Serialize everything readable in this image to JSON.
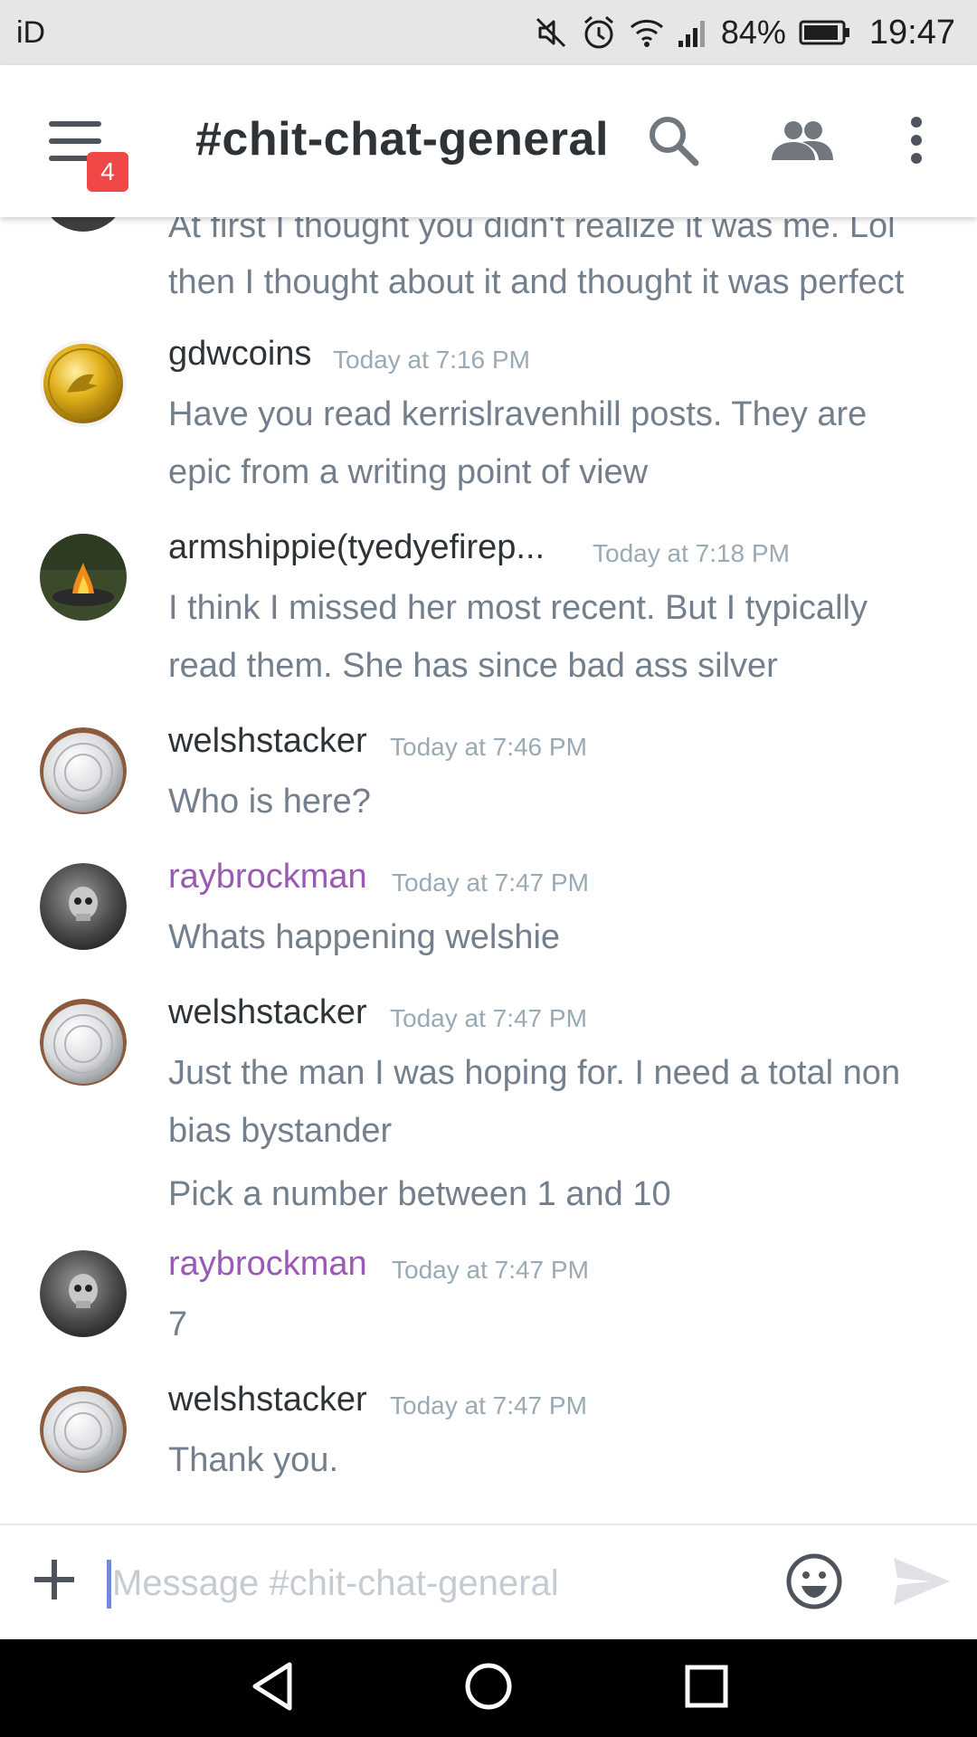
{
  "status_bar": {
    "carrier": "iD",
    "battery_percent": "84%",
    "time": "19:47",
    "icons": [
      "mute-icon",
      "alarm-icon",
      "wifi-icon",
      "signal-icon",
      "battery-icon"
    ],
    "background": "#e6e6e6"
  },
  "header": {
    "unread_badge": "4",
    "channel_title": "#chit-chat-general",
    "icons": [
      "menu-icon",
      "search-icon",
      "members-icon",
      "overflow-menu-icon"
    ],
    "badge_color": "#f04747"
  },
  "messages": [
    {
      "author": "",
      "timestamp": "",
      "lines": [
        "At first I thought you didn't realize it was me.  Lol",
        "then I thought about it and thought it was perfect"
      ],
      "avatar": "partial-avatar"
    },
    {
      "author": "gdwcoins",
      "timestamp": "Today at 7:16 PM",
      "lines": [
        "Have you read kerrislravenhill posts. They are",
        "epic from a writing point of view"
      ],
      "avatar": "gold-coin-avatar"
    },
    {
      "author": "armshippie(tyedyefirep...",
      "timestamp": "Today at 7:18 PM",
      "lines": [
        "I think I missed her most recent. But I typically",
        "read them. She has since bad ass silver"
      ],
      "avatar": "campfire-avatar"
    },
    {
      "author": "welshstacker",
      "timestamp": "Today at 7:46 PM",
      "lines": [
        "Who is here?"
      ],
      "avatar": "silver-coin-avatar"
    },
    {
      "author": "raybrockman",
      "timestamp": "Today at 7:47 PM",
      "lines": [
        "Whats happening welshie"
      ],
      "avatar": "skull-coin-avatar",
      "author_color": "#9b59b6"
    },
    {
      "author": "welshstacker",
      "timestamp": "Today at 7:47 PM",
      "lines": [
        "Just the man I was hoping for. I need a total non",
        "bias bystander",
        "Pick a number between 1 and 10"
      ],
      "avatar": "silver-coin-avatar"
    },
    {
      "author": "raybrockman",
      "timestamp": "Today at 7:47 PM",
      "lines": [
        "7"
      ],
      "avatar": "skull-coin-avatar",
      "author_color": "#9b59b6"
    },
    {
      "author": "welshstacker",
      "timestamp": "Today at 7:47 PM",
      "lines": [
        "Thank you."
      ],
      "avatar": "silver-coin-avatar"
    }
  ],
  "composer": {
    "placeholder": "Message #chit-chat-general",
    "value": "",
    "icons": [
      "plus-icon",
      "emoji-icon",
      "send-icon"
    ]
  },
  "nav_bar": {
    "icons": [
      "back-icon",
      "home-icon",
      "recents-icon"
    ]
  },
  "colors": {
    "text_primary": "#2e3338",
    "text_message": "#737f8d",
    "timestamp": "#99aab5",
    "author_highlight": "#9b59b6"
  }
}
